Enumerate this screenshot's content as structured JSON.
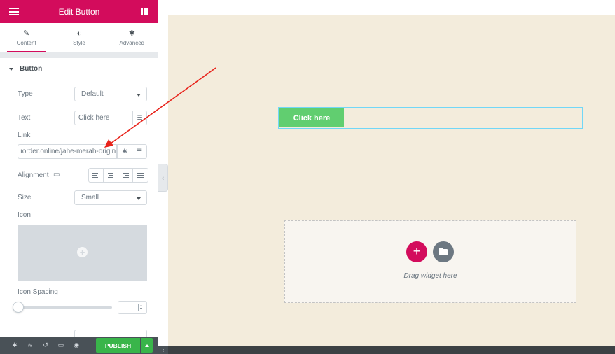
{
  "panel": {
    "title": "Edit Button",
    "tabs": [
      {
        "label": "Content",
        "icon": "pencil-icon"
      },
      {
        "label": "Style",
        "icon": "contrast-icon"
      },
      {
        "label": "Advanced",
        "icon": "gear-icon"
      }
    ],
    "section_title": "Button",
    "fields": {
      "type_label": "Type",
      "type_value": "Default",
      "text_label": "Text",
      "text_value": "Click here",
      "link_label": "Link",
      "link_value": "ıorder.online/jahe-merah-original",
      "alignment_label": "Alignment",
      "size_label": "Size",
      "size_value": "Small",
      "icon_label": "Icon",
      "icon_spacing_label": "Icon Spacing"
    }
  },
  "footer": {
    "publish_label": "PUBLISH",
    "icons": [
      "gear-icon",
      "layers-icon",
      "history-icon",
      "responsive-icon",
      "eye-icon"
    ]
  },
  "preview": {
    "button_text": "Click here",
    "drop_zone_text": "Drag widget here"
  },
  "colors": {
    "brand": "#d30c5c",
    "publish": "#39b54a",
    "button": "#61ce70",
    "canvas": "#f3ecdc",
    "annotation": "#e8231b"
  }
}
